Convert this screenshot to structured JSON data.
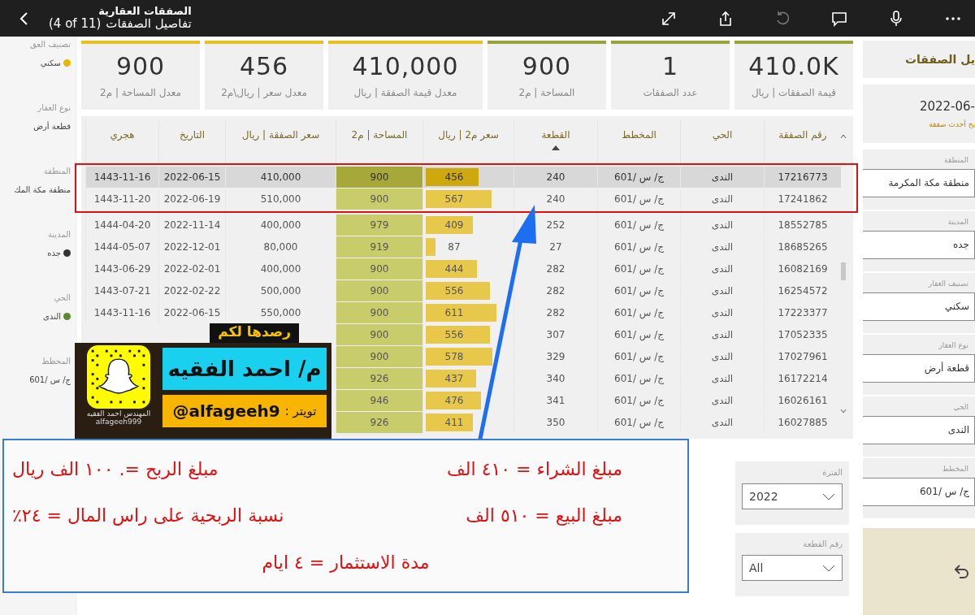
{
  "app_bar": {
    "title": "الصفقات العقارية",
    "subtitle": "تفاصيل الصفقات",
    "page_counter": "(4 of 11)"
  },
  "left_filters": [
    {
      "label": "تصنيف العق",
      "value": "سكني",
      "color": "#e6b800"
    },
    {
      "label": "نوع العقار",
      "value": "قطعة أرض"
    },
    {
      "label": "المنطقة",
      "value": "منطقة مكة المك"
    },
    {
      "label": "المدينة",
      "value": "جده",
      "color": "#333333"
    },
    {
      "label": "الحي",
      "value": "الندى",
      "color": "#5a8a2e"
    },
    {
      "label": "المخطط",
      "value": "ج/ س /601"
    }
  ],
  "kpis": [
    {
      "value": "410.0K",
      "label": "قيمة الصفقات | ريال",
      "color": "#9aa23a"
    },
    {
      "value": "1",
      "label": "عدد الصفقات",
      "color": "#9aa23a"
    },
    {
      "value": "900",
      "label": "المساحة | م2",
      "color": "#9aa23a"
    },
    {
      "value": "410,000",
      "label": "معدل قيمة الصفقة | ريال",
      "color": "#e8c11e"
    },
    {
      "value": "456",
      "label": "معدل سعر | ريال\\م2",
      "color": "#e8c11e"
    },
    {
      "value": "900",
      "label": "معدل المساحة | م2",
      "color": "#e8c11e"
    }
  ],
  "table": {
    "columns": [
      {
        "label": "رقم الصفقة",
        "sorted": false
      },
      {
        "label": "الحي",
        "sorted": false
      },
      {
        "label": "المخطط",
        "sorted": false
      },
      {
        "label": "القطعة",
        "sorted": true
      },
      {
        "label": "سعر م2 | ريال",
        "sorted": false
      },
      {
        "label": "المساحة | م2",
        "sorted": false
      },
      {
        "label": "سعر الصفقة | ريال",
        "sorted": false
      },
      {
        "label": "التاريخ",
        "sorted": false
      },
      {
        "label": "هجري",
        "sorted": false
      }
    ],
    "rows": [
      {
        "selected": true,
        "id": "17216773",
        "district": "الندى",
        "plan": "ج/ س /601",
        "plot": "240",
        "ppm": "456",
        "level": 0.65,
        "area": "900",
        "price": "410,000",
        "date": "2022-06-15",
        "hijri": "1443-11-16"
      },
      {
        "selected": false,
        "id": "17241862",
        "district": "الندى",
        "plan": "ج/ س /601",
        "plot": "240",
        "ppm": "567",
        "level": 0.81,
        "area": "900",
        "price": "510,000",
        "date": "2022-06-19",
        "hijri": "1443-11-20"
      },
      {
        "selected": false,
        "id": "18552785",
        "district": "الندى",
        "plan": "ج/ س /601",
        "plot": "252",
        "ppm": "409",
        "level": 0.58,
        "area": "979",
        "price": "400,000",
        "date": "2022-11-14",
        "hijri": "1444-04-20"
      },
      {
        "selected": false,
        "id": "18685265",
        "district": "الندى",
        "plan": "ج/ س /601",
        "plot": "27",
        "ppm": "87",
        "level": 0.12,
        "area": "919",
        "price": "80,000",
        "date": "2022-12-01",
        "hijri": "1444-05-07"
      },
      {
        "selected": false,
        "id": "16082169",
        "district": "الندى",
        "plan": "ج/ س /601",
        "plot": "282",
        "ppm": "444",
        "level": 0.63,
        "area": "900",
        "price": "400,000",
        "date": "2022-02-01",
        "hijri": "1443-06-29"
      },
      {
        "selected": false,
        "id": "16254572",
        "district": "الندى",
        "plan": "ج/ س /601",
        "plot": "282",
        "ppm": "556",
        "level": 0.79,
        "area": "900",
        "price": "500,000",
        "date": "2022-02-22",
        "hijri": "1443-07-21"
      },
      {
        "selected": false,
        "id": "17223377",
        "district": "الندى",
        "plan": "ج/ س /601",
        "plot": "282",
        "ppm": "611",
        "level": 0.87,
        "area": "900",
        "price": "550,000",
        "date": "2022-06-15",
        "hijri": "1443-11-16"
      },
      {
        "selected": false,
        "id": "17052335",
        "district": "الندى",
        "plan": "ج/ س /601",
        "plot": "307",
        "ppm": "556",
        "level": 0.79,
        "area": "900"
      },
      {
        "selected": false,
        "id": "17027961",
        "district": "الندى",
        "plan": "ج/ س /601",
        "plot": "329",
        "ppm": "578",
        "level": 0.82,
        "area": "900"
      },
      {
        "selected": false,
        "id": "16172214",
        "district": "الندى",
        "plan": "ج/ س /601",
        "plot": "340",
        "ppm": "437",
        "level": 0.62,
        "area": "926"
      },
      {
        "selected": false,
        "id": "16026161",
        "district": "الندى",
        "plan": "ج/ س /601",
        "plot": "341",
        "ppm": "476",
        "level": 0.68,
        "area": "946"
      },
      {
        "selected": false,
        "id": "16027885",
        "district": "الندى",
        "plan": "ج/ س /601",
        "plot": "350",
        "ppm": "411",
        "level": 0.58,
        "area": "926"
      }
    ]
  },
  "bottom_filters": [
    {
      "label": "الفترة",
      "value": "2022"
    },
    {
      "label": "رقم القطعة",
      "value": "All"
    }
  ],
  "right_panel": {
    "title": "يل الصفقات",
    "latest_date": "2022-06-",
    "latest_label": "يخ أحدث صفقة",
    "filters": [
      {
        "label": "المنطقة",
        "value": "منطقة مكة المكرمة"
      },
      {
        "label": "المدينة",
        "value": "جده"
      },
      {
        "label": "تصنيف العقار",
        "value": "سكني"
      },
      {
        "label": "نوع العقار",
        "value": "قطعة أرض"
      },
      {
        "label": "الحي",
        "value": "الندى"
      },
      {
        "label": "المخطط",
        "value": "ج/ س /601"
      }
    ]
  },
  "sticker": {
    "tagline": "رصدها لكم",
    "name": "م/ احمد الفقيه",
    "twitter_label": "تويتر :",
    "handle": "@alfageeh9",
    "caption": "المهندس احمد الفقيه",
    "caption_handle": "alfageeh999"
  },
  "annotation": {
    "lines": [
      "مبلغ الشراء = ٤١٠ الف",
      "مبلغ الربح  =. ١٠٠ الف ريال",
      "مبلغ البيع = ٥١٠ الف",
      "نسبة الربحية على راس المال = ٢٤٪",
      "مدة الاستثمار = ٤ ايام"
    ]
  }
}
